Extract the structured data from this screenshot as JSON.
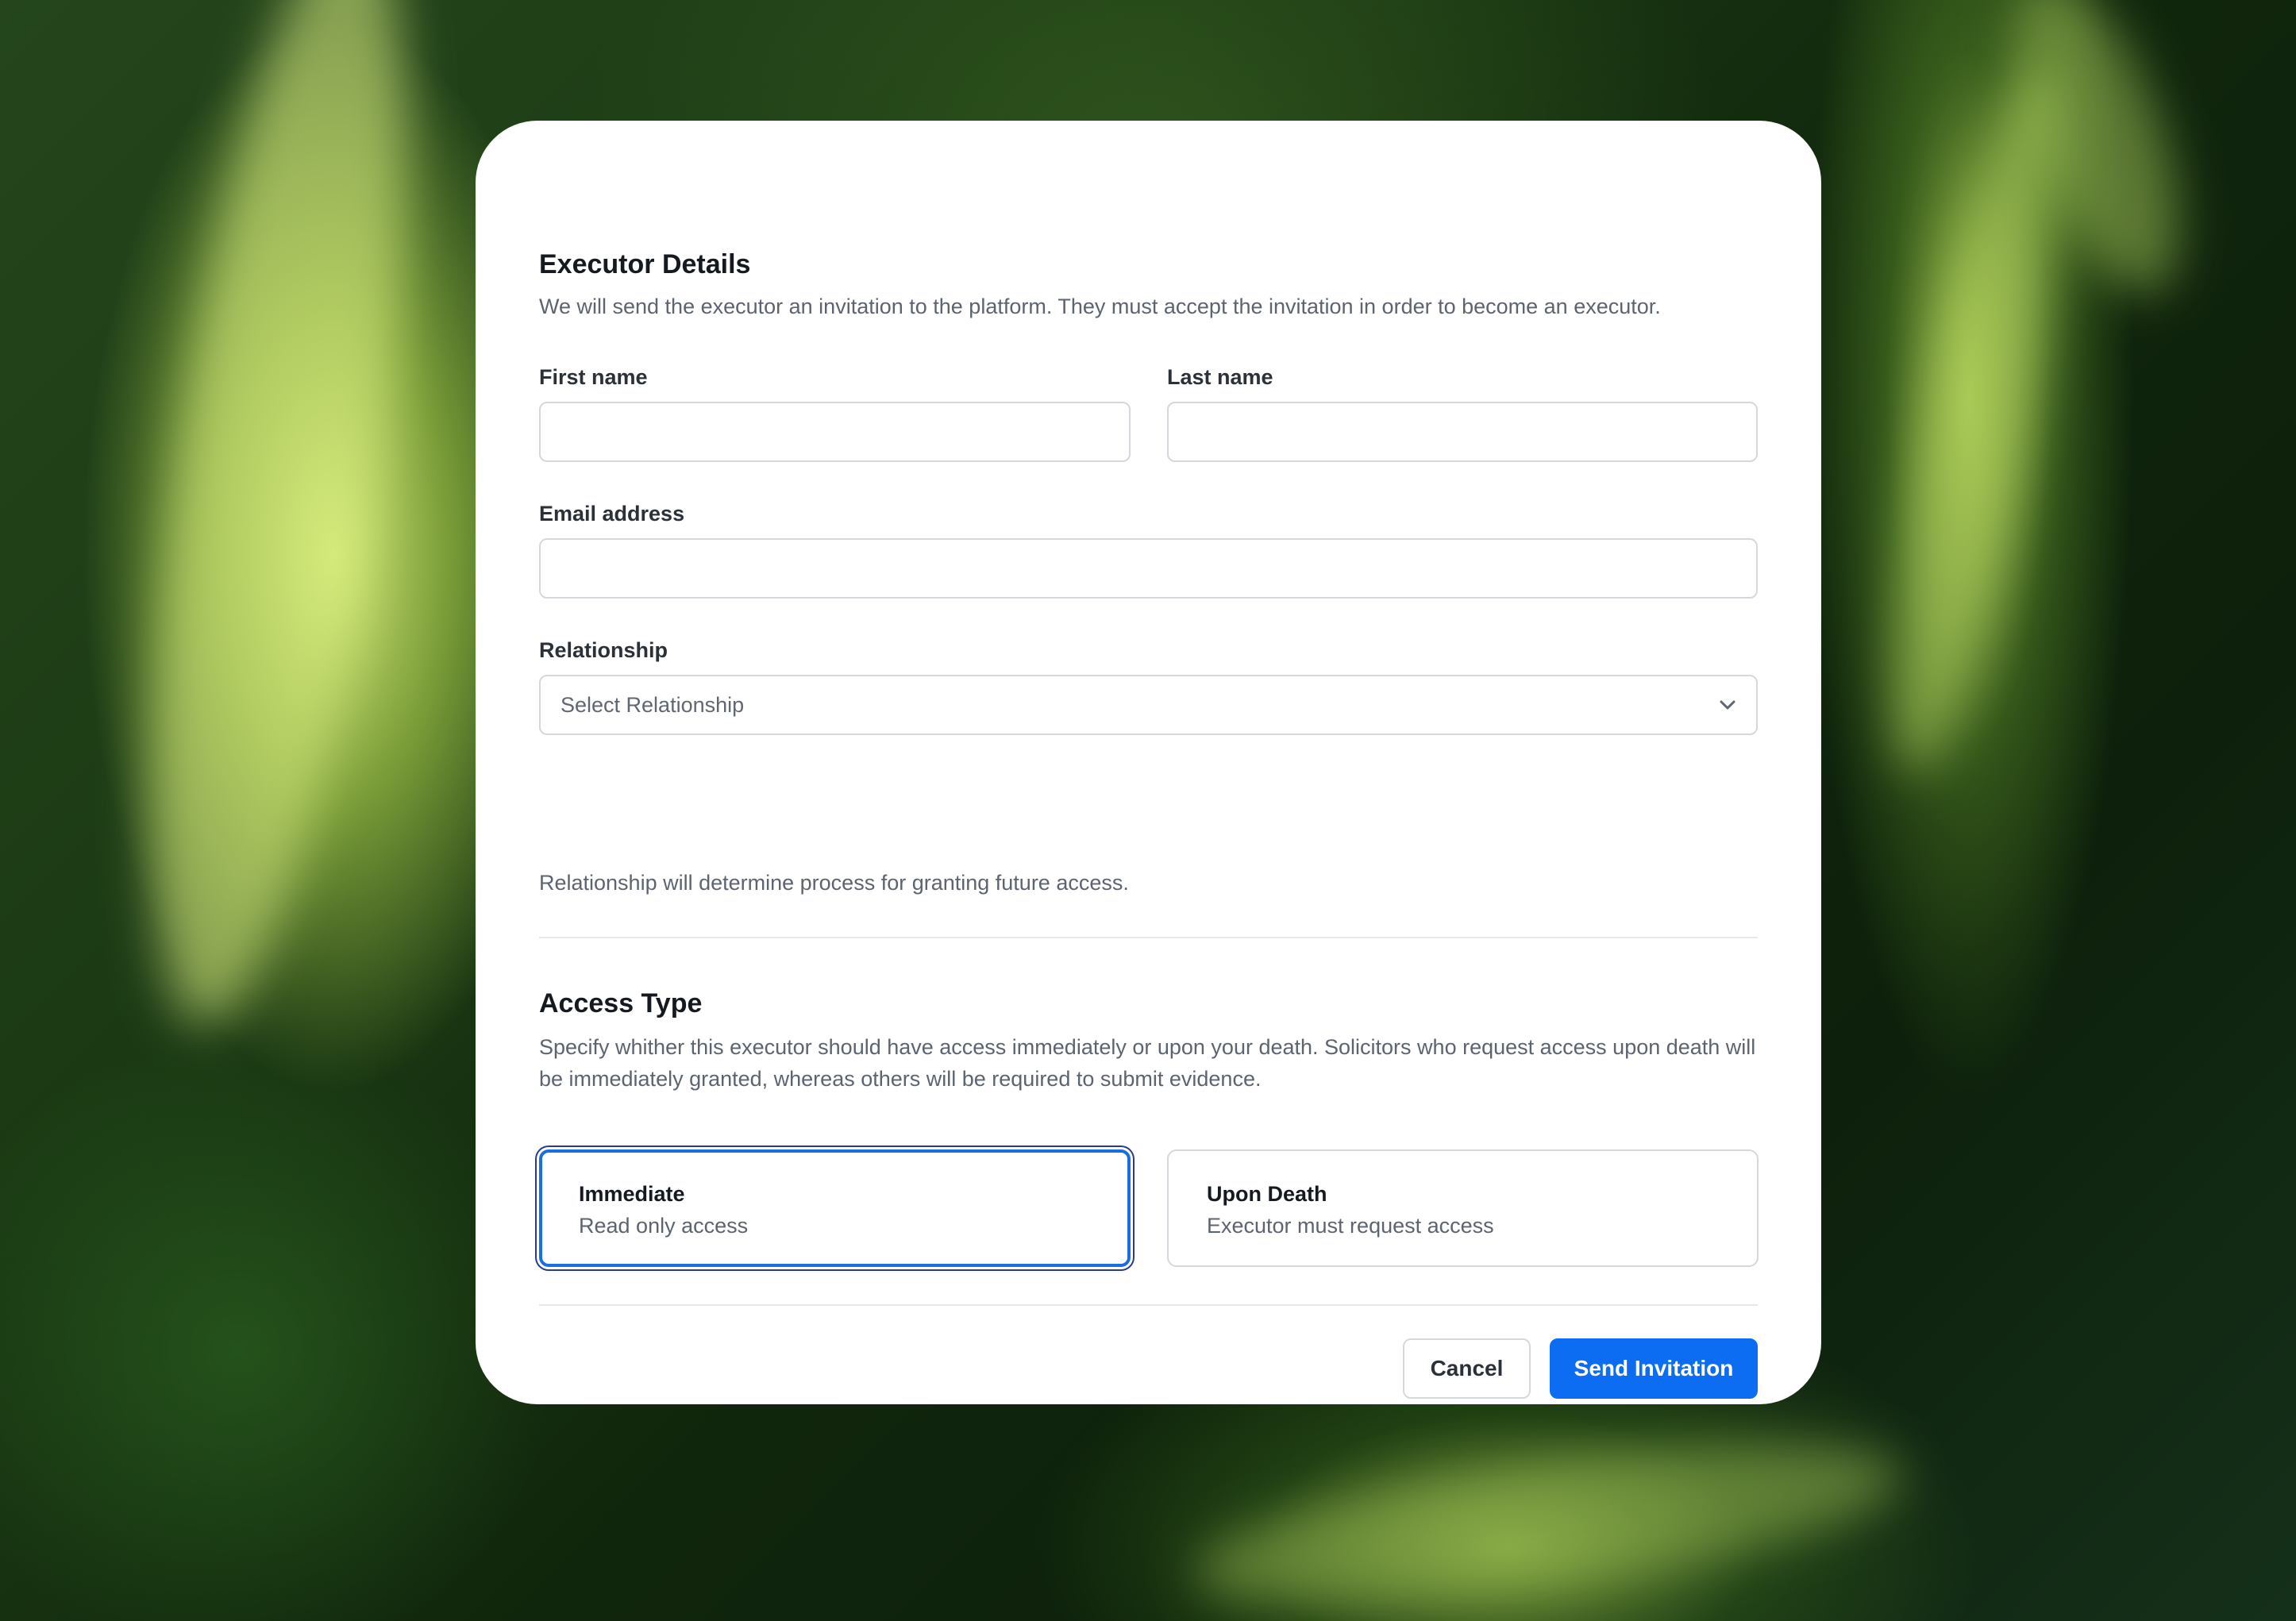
{
  "executor_details": {
    "title": "Executor Details",
    "description": "We will send the executor an invitation to the platform. They must accept the invitation in order to become an executor.",
    "first_name": {
      "label": "First name",
      "value": ""
    },
    "last_name": {
      "label": "Last name",
      "value": ""
    },
    "email": {
      "label": "Email address",
      "value": ""
    },
    "relationship": {
      "label": "Relationship",
      "selected": "Select Relationship",
      "help": "Relationship will determine process for granting future access."
    }
  },
  "access_type": {
    "title": "Access Type",
    "description": "Specify whither this executor should have access immediately or upon your death. Solicitors who request access upon death will be immediately granted, whereas others will be required to submit evidence.",
    "options": [
      {
        "title": "Immediate",
        "subtitle": "Read only access",
        "selected": true
      },
      {
        "title": "Upon Death",
        "subtitle": "Executor must request access",
        "selected": false
      }
    ]
  },
  "actions": {
    "cancel_label": "Cancel",
    "send_label": "Send Invitation"
  },
  "colors": {
    "primary": "#0c6cf2",
    "selected_border": "#1a6fe0",
    "text_dark": "#141a1f",
    "text_muted": "#5c6470",
    "border": "#d4d7dc"
  },
  "icons": {
    "relationship_dropdown": "chevron-down-icon"
  }
}
